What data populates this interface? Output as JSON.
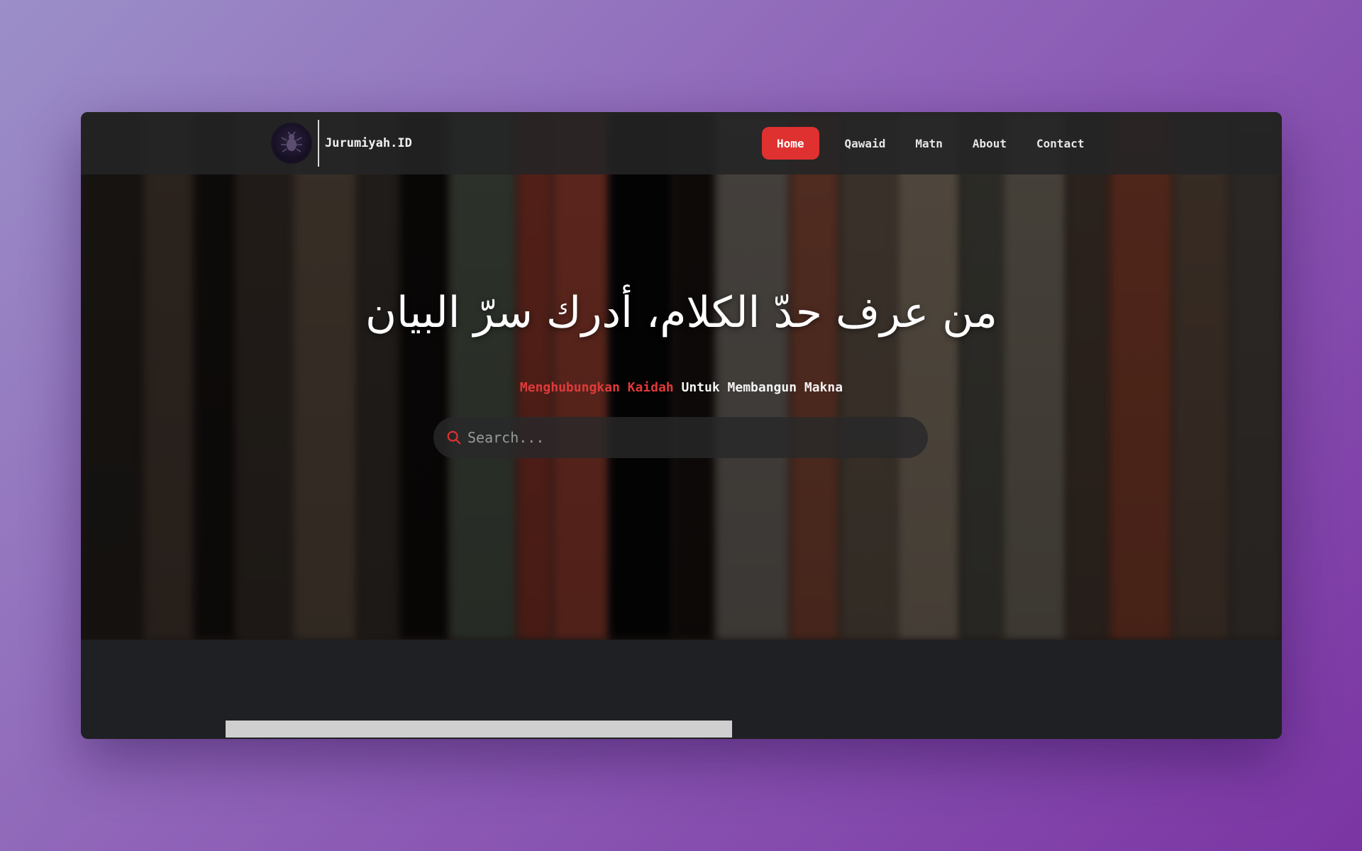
{
  "brand": {
    "name": "Jurumiyah.ID"
  },
  "nav": {
    "items": [
      {
        "label": "Home",
        "active": true
      },
      {
        "label": "Qawaid",
        "active": false
      },
      {
        "label": "Matn",
        "active": false
      },
      {
        "label": "About",
        "active": false
      },
      {
        "label": "Contact",
        "active": false
      }
    ]
  },
  "hero": {
    "title": "من عرف حدّ الكلام، أدرك سرّ البيان",
    "tagline_accent": "Menghubungkan Kaidah",
    "tagline_rest": " Untuk Membangun Makna",
    "search_placeholder": "Search..."
  },
  "colors": {
    "accent": "#e03131",
    "page_gradient_start": "#9b8fc8",
    "page_gradient_end": "#7b35a3"
  },
  "icons": {
    "search": "search-icon",
    "logo": "beetle-logo-icon"
  }
}
